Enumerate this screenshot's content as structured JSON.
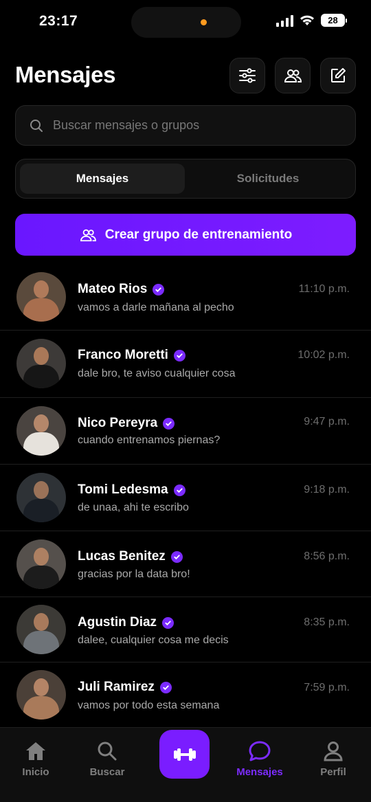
{
  "status_bar": {
    "time": "23:17",
    "battery": "28"
  },
  "header": {
    "title": "Mensajes"
  },
  "search": {
    "placeholder": "Buscar mensajes o grupos"
  },
  "tabs": {
    "active": "Mensajes",
    "inactive": "Solicitudes"
  },
  "cta": {
    "label": "Crear grupo de entrenamiento"
  },
  "conversations": [
    {
      "name": "Mateo Rios",
      "message": "vamos a darle mañana al pecho",
      "time": "11:10 p.m."
    },
    {
      "name": "Franco Moretti",
      "message": "dale bro, te aviso cualquier cosa",
      "time": "10:02 p.m."
    },
    {
      "name": "Nico Pereyra",
      "message": "cuando entrenamos piernas?",
      "time": "9:47 p.m."
    },
    {
      "name": "Tomi Ledesma",
      "message": "de unaa, ahi te escribo",
      "time": "9:18 p.m."
    },
    {
      "name": "Lucas Benitez",
      "message": "gracias por la data bro!",
      "time": "8:56 p.m."
    },
    {
      "name": "Agustin Diaz",
      "message": "dalee, cualquier cosa me decis",
      "time": "8:35 p.m."
    },
    {
      "name": "Juli Ramirez",
      "message": "vamos por todo esta semana",
      "time": "7:59 p.m."
    }
  ],
  "nav": {
    "home": "Inicio",
    "search": "Buscar",
    "messages": "Mensajes",
    "profile": "Perfil"
  },
  "colors": {
    "accent": "#7b2bff",
    "background": "#000000"
  },
  "icons": [
    "filter-icon",
    "group-icon",
    "compose-icon",
    "search-icon",
    "dumbbell-icon",
    "chat-icon",
    "home-icon",
    "person-icon",
    "verified-icon"
  ]
}
